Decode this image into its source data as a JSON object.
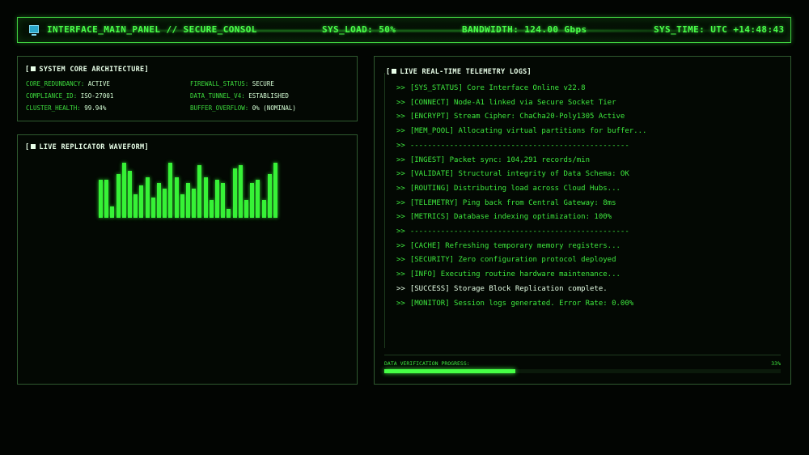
{
  "header": {
    "title": "INTERFACE_MAIN_PANEL // SECURE_CONSOL",
    "sys_load": "SYS_LOAD: 50%",
    "bandwidth": "BANDWIDTH: 124.00 Gbps",
    "sys_time": "SYS_TIME: UTC +14:48:43"
  },
  "core_panel": {
    "title": "SYSTEM CORE ARCHITECTURE",
    "left": [
      {
        "key": "CORE_REDUNDANCY:",
        "value": "ACTIVE"
      },
      {
        "key": "COMPLIANCE_ID:",
        "value": "ISO-27001"
      },
      {
        "key": "CLUSTER_HEALTH:",
        "value": "99.94%"
      }
    ],
    "right": [
      {
        "key": "FIREWALL_STATUS:",
        "value": "SECURE"
      },
      {
        "key": "DATA_TUNNEL_V4:",
        "value": "ESTABLISHED"
      },
      {
        "key": "BUFFER_OVERFLOW:",
        "value": "0% (NOMINAL)"
      }
    ]
  },
  "wave_panel": {
    "title": "LIVE REPLICATOR WAVEFORM",
    "levels": [
      0.65,
      0.65,
      0.2,
      0.75,
      0.95,
      0.8,
      0.4,
      0.55,
      0.7,
      0.35,
      0.6,
      0.5,
      0.95,
      0.7,
      0.4,
      0.6,
      0.5,
      0.9,
      0.7,
      0.3,
      0.65,
      0.6,
      0.15,
      0.85,
      0.9,
      0.3,
      0.6,
      0.65,
      0.3,
      0.75,
      0.95
    ],
    "bar_color": "#37f237"
  },
  "log_panel": {
    "title": "LIVE REAL-TIME TELEMETRY LOGS",
    "prefix": ">>",
    "lines": [
      {
        "text": "[SYS_STATUS] Core Interface Online v22.8",
        "white": false
      },
      {
        "text": "[CONNECT] Node-A1 linked via Secure Socket Tier",
        "white": false
      },
      {
        "text": "[ENCRYPT] Stream Cipher: ChaCha20-Poly1305 Active",
        "white": false
      },
      {
        "text": "[MEM_POOL] Allocating virtual partitions for buffer...",
        "white": false
      },
      {
        "text": "--------------------------------------------------",
        "white": false
      },
      {
        "text": "[INGEST] Packet sync: 104,291 records/min",
        "white": false
      },
      {
        "text": "[VALIDATE] Structural integrity of Data Schema: OK",
        "white": false
      },
      {
        "text": "[ROUTING] Distributing load across Cloud Hubs...",
        "white": false
      },
      {
        "text": "[TELEMETRY] Ping back from Central Gateway: 8ms",
        "white": false
      },
      {
        "text": "[METRICS] Database indexing optimization: 100%",
        "white": false
      },
      {
        "text": "--------------------------------------------------",
        "white": false
      },
      {
        "text": "[CACHE] Refreshing temporary memory registers...",
        "white": false
      },
      {
        "text": "[SECURITY] Zero configuration protocol deployed",
        "white": false
      },
      {
        "text": "[INFO] Executing routine hardware maintenance...",
        "white": false
      },
      {
        "text": "[SUCCESS] Storage Block Replication complete.",
        "white": true
      },
      {
        "text": "[MONITOR] Session logs generated. Error Rate: 0.00%",
        "white": false
      }
    ],
    "progress_label": "DATA VERIFICATION PROGRESS:",
    "progress_pct": "33%",
    "progress_value": 0.33
  },
  "icons": {
    "header": "terminal-icon",
    "panel_marker": "square-bullet-icon"
  },
  "colors": {
    "accent": "#49ff49",
    "text_white": "#e6ffe6",
    "background": "#020502"
  }
}
